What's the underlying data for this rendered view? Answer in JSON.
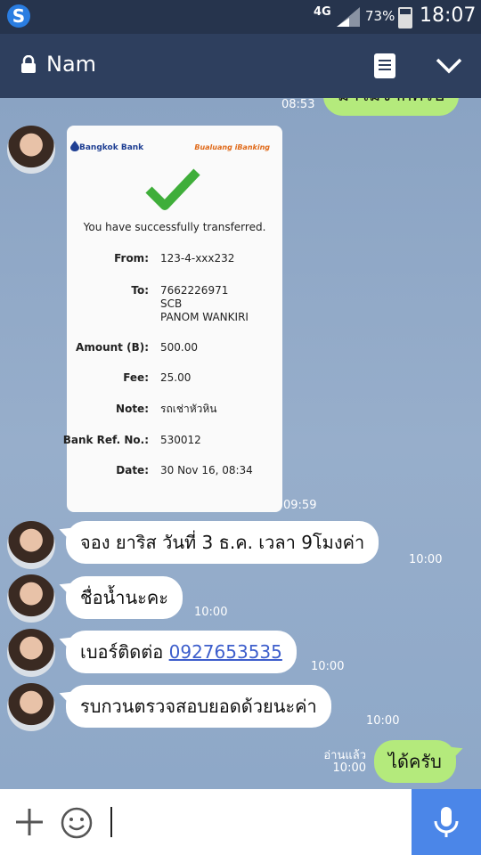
{
  "status_bar": {
    "network": "4G",
    "battery": "73%",
    "time": "18:07"
  },
  "header": {
    "contact_name": "Nam"
  },
  "colors": {
    "header_bg": "#2e3f5e",
    "status_bg": "#26344d",
    "outgoing_bubble": "#b4ea7c",
    "incoming_bubble": "#ffffff",
    "mic_button": "#4b86e8"
  },
  "chat": {
    "prev_out_message": {
      "text": "มาโมจากครับ",
      "time": "08:53"
    },
    "receipt": {
      "bank_name": "Bangkok Bank",
      "service_name": "Bualuang iBanking",
      "success_text": "You have successfully transferred.",
      "rows": [
        {
          "label": "From:",
          "value": "123-4-xxx232"
        },
        {
          "label": "To:",
          "value": "7662226971\nSCB\nPANOM WANKIRI"
        },
        {
          "label": "Amount (B):",
          "value": "500.00"
        },
        {
          "label": "Fee:",
          "value": "25.00"
        },
        {
          "label": "Note:",
          "value": "รถเช่าหัวหิน"
        },
        {
          "label": "Bank Ref. No.:",
          "value": "530012"
        },
        {
          "label": "Date:",
          "value": "30 Nov 16, 08:34"
        }
      ],
      "time": "09:59"
    },
    "messages_in": [
      {
        "text": "จอง ยาริส วันที่ 3 ธ.ค. เวลา 9โมงค่า",
        "time": "10:00"
      },
      {
        "text": "ชื่อน้ำนะคะ",
        "time": "10:00"
      },
      {
        "prefix": "เบอร์ติดต่อ ",
        "link": "0927653535",
        "time": "10:00"
      },
      {
        "text": "รบกวนตรวจสอบยอดด้วยนะค่า",
        "time": "10:00"
      }
    ],
    "reply_out": {
      "text": "ได้ครับ",
      "read_label": "อ่านแล้ว",
      "time": "10:00"
    }
  },
  "input_bar": {
    "icons": [
      "plus-icon",
      "smiley-icon",
      "microphone-icon"
    ]
  }
}
